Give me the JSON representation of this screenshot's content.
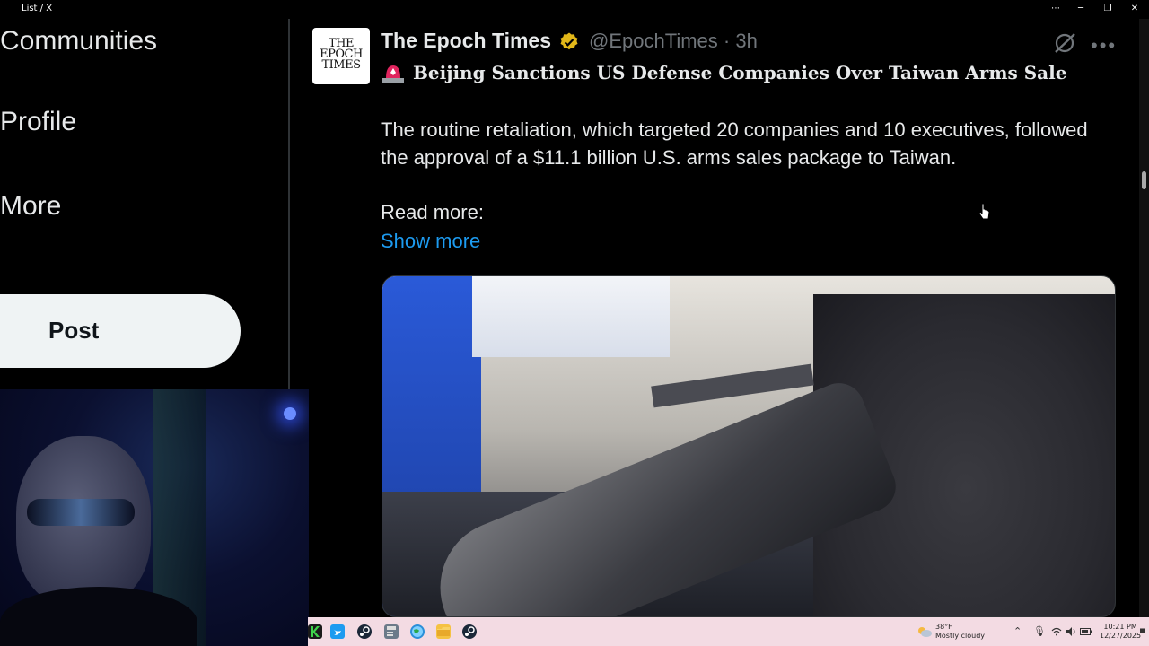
{
  "window": {
    "title": "List / X",
    "minimize": "─",
    "maximize": "❐",
    "close": "✕",
    "more": "⋯"
  },
  "sidebar": {
    "items": [
      {
        "label": "Communities"
      },
      {
        "label": "Profile"
      },
      {
        "label": "More"
      }
    ],
    "post_label": "Post"
  },
  "post": {
    "avatar_text": "THE EPOCH TIMES",
    "author": "The Epoch Times",
    "handle_time": "@EpochTimes · 3h",
    "headline": "Beijing Sanctions US Defense Companies Over Taiwan Arms Sale",
    "body": "The routine retaliation, which targeted 20 companies and 10 executives, followed the approval of a $11.1 billion U.S. arms sales package to Taiwan.",
    "read_more": "Read more:",
    "show_more": "Show more",
    "more_icon": "•••"
  },
  "taskbar": {
    "weather_temp": "38°F",
    "weather_desc": "Mostly cloudy",
    "time": "10:21 PM",
    "date": "12/27/2025"
  },
  "colors": {
    "accent": "#1d9bf0",
    "background": "#000000",
    "text": "#e7e9ea",
    "muted": "#71767b",
    "verified": "#e2b719"
  }
}
